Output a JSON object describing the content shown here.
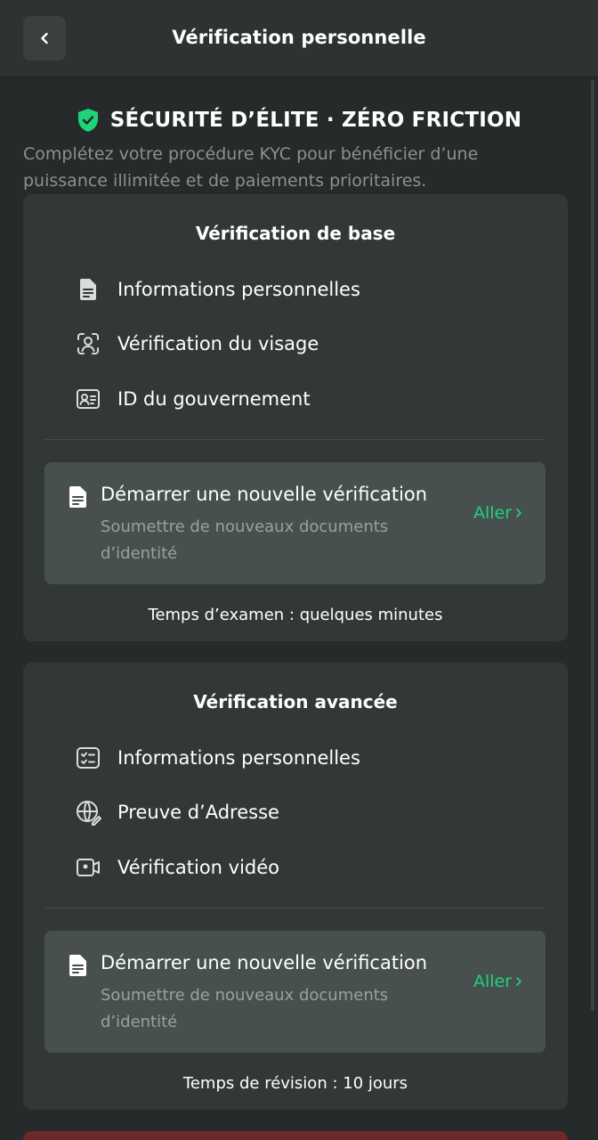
{
  "header": {
    "title": "Vérification personnelle",
    "back_icon": "chevron-left-icon"
  },
  "hero": {
    "title": "SÉCURITÉ D’ÉLITE · ZÉRO FRICTION",
    "icon": "shield-check-icon",
    "subtitle": "Complétez votre procédure KYC pour bénéficier d’une puissance illimitée et de paiements prioritaires."
  },
  "basic": {
    "title": "Vérification de base",
    "features": [
      {
        "label": "Informations personnelles",
        "icon": "document-icon"
      },
      {
        "label": "Vérification du visage",
        "icon": "face-scan-icon"
      },
      {
        "label": "ID du gouvernement",
        "icon": "id-card-icon"
      }
    ],
    "action": {
      "title": "Démarrer une nouvelle vérification",
      "description": "Soumettre de nouveaux documents d’identité",
      "go_label": "Aller"
    },
    "review_time": "Temps d’examen : quelques minutes"
  },
  "advanced": {
    "title": "Vérification avancée",
    "features": [
      {
        "label": "Informations personnelles",
        "icon": "checklist-icon"
      },
      {
        "label": "Preuve d’Adresse",
        "icon": "globe-edit-icon"
      },
      {
        "label": "Vérification vidéo",
        "icon": "video-camera-icon"
      }
    ],
    "action": {
      "title": "Démarrer une nouvelle vérification",
      "description": "Soumettre de nouveaux documents d’identité",
      "go_label": "Aller"
    },
    "review_time": "Temps de révision : 10 jours"
  },
  "colors": {
    "background": "#262a2a",
    "card": "#323838",
    "action_box": "#474f4f",
    "accent_green": "#1ed37a",
    "muted_text": "#8b9191"
  }
}
